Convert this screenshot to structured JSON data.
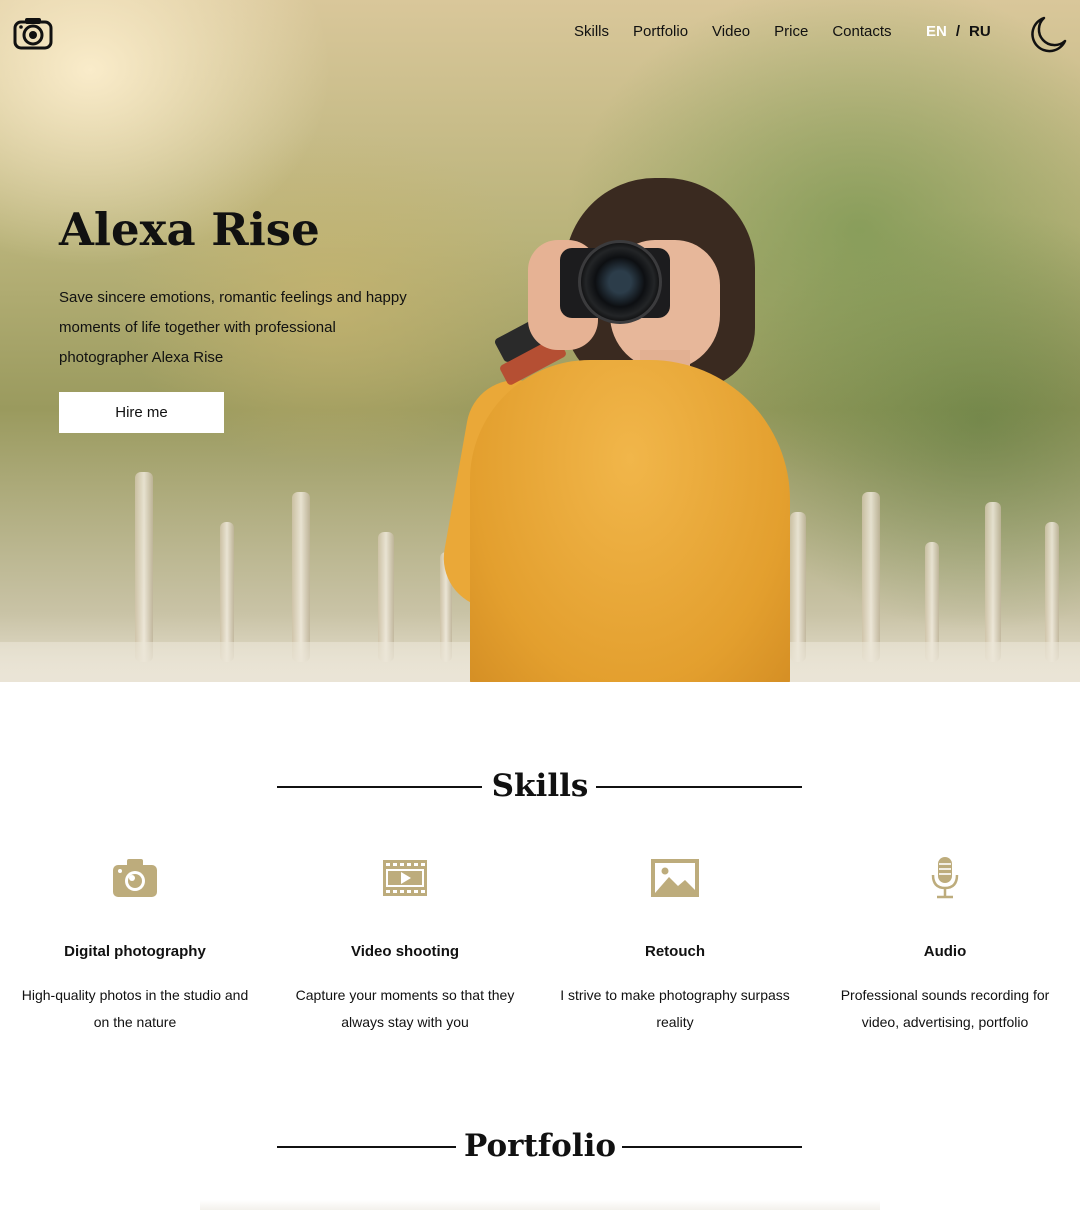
{
  "nav": {
    "items": [
      "Skills",
      "Portfolio",
      "Video",
      "Price",
      "Contacts"
    ],
    "lang_en": "EN",
    "lang_sep": "/",
    "lang_ru": "RU"
  },
  "hero": {
    "title": "Alexa Rise",
    "description": "Save sincere emotions, romantic feelings and happy moments of life together with professional photographer Alexa Rise",
    "button": "Hire me"
  },
  "skills": {
    "title": "Skills",
    "items": [
      {
        "icon": "camera-icon",
        "title": "Digital photography",
        "desc": "High-quality photos in the studio and on the nature"
      },
      {
        "icon": "video-icon",
        "title": "Video shooting",
        "desc": "Capture your moments so that they always stay with you"
      },
      {
        "icon": "image-icon",
        "title": "Retouch",
        "desc": "I strive to make photography surpass reality"
      },
      {
        "icon": "microphone-icon",
        "title": "Audio",
        "desc": "Professional sounds recording for video, advertising, portfolio"
      }
    ]
  },
  "portfolio": {
    "title": "Portfolio"
  },
  "colors": {
    "accent": "#bdac7c",
    "text": "#111111",
    "lang_active": "#ffffff"
  }
}
